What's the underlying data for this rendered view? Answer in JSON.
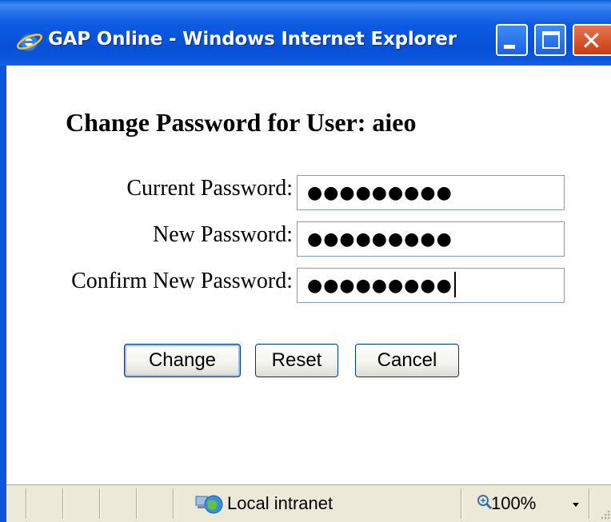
{
  "window": {
    "title": "GAP Online - Windows Internet Explorer",
    "icon": "ie-logo-icon",
    "controls": [
      "minimize-icon",
      "maximize-icon",
      "close-icon"
    ]
  },
  "form": {
    "heading": "Change Password for User: aieo",
    "fields": [
      {
        "label": "Current Password:",
        "masked_value": "●●●●●●●●●"
      },
      {
        "label": "New Password:",
        "masked_value": "●●●●●●●●●"
      },
      {
        "label": "Confirm New Password:",
        "masked_value": "●●●●●●●●●"
      }
    ],
    "buttons": {
      "change": "Change",
      "reset": "Reset",
      "cancel": "Cancel"
    }
  },
  "statusbar": {
    "zone_icon": "local-intranet-icon",
    "zone": "Local intranet",
    "zoom_icon": "magnifier-icon",
    "zoom": "100%"
  },
  "colors": {
    "titlebar_blue": "#0a56dc",
    "close_red": "#c83c12",
    "statusbar_bg": "#ece9d8",
    "input_border": "#7f9db9"
  }
}
